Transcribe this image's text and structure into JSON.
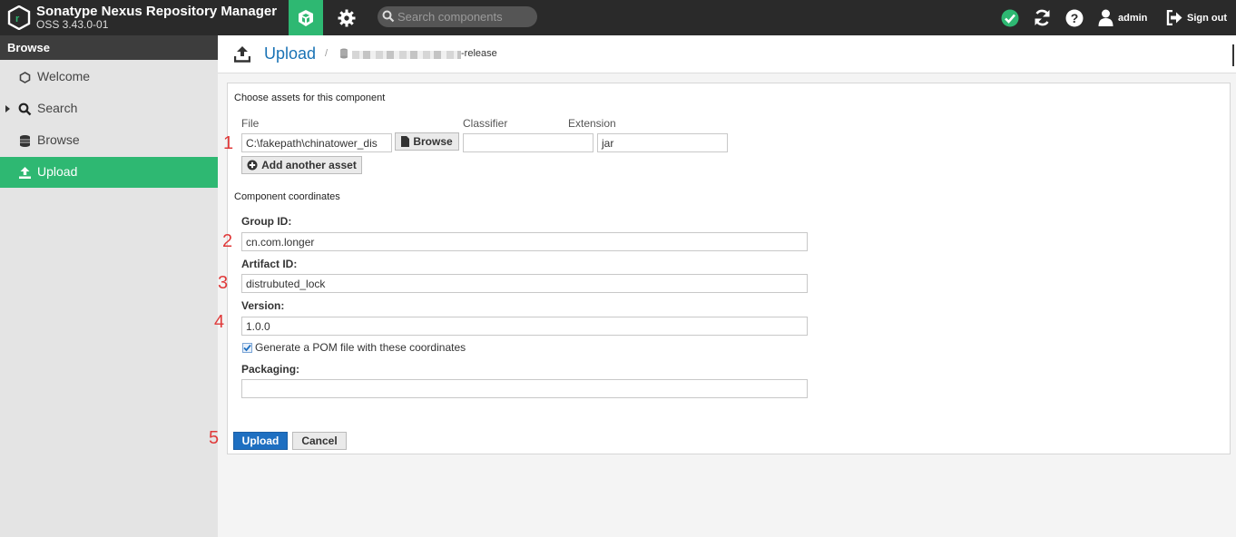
{
  "app": {
    "title": "Sonatype Nexus Repository Manager",
    "version": "OSS 3.43.0-01"
  },
  "header": {
    "search_placeholder": "Search components",
    "user_label": "admin",
    "signout_label": "Sign out"
  },
  "sidebar": {
    "section": "Browse",
    "items": [
      {
        "label": "Welcome",
        "icon": "hexagon-icon"
      },
      {
        "label": "Search",
        "icon": "search-icon"
      },
      {
        "label": "Browse",
        "icon": "database-icon"
      },
      {
        "label": "Upload",
        "icon": "upload-icon",
        "active": true
      }
    ]
  },
  "page": {
    "title": "Upload",
    "repo_suffix": "-release"
  },
  "assets": {
    "section_title": "Choose assets for this component",
    "file_label": "File",
    "classifier_label": "Classifier",
    "extension_label": "Extension",
    "file_value": "C:\\fakepath\\chinatower_dis",
    "browse_label": "Browse",
    "classifier_value": "",
    "extension_value": "jar",
    "add_asset_label": "Add another asset"
  },
  "coordinates": {
    "section_title": "Component coordinates",
    "group_label": "Group ID:",
    "group_value": "cn.com.longer",
    "artifact_label": "Artifact ID:",
    "artifact_value": "distrubuted_lock",
    "version_label": "Version:",
    "version_value": "1.0.0",
    "pom_label": "Generate a POM file with these coordinates",
    "pom_checked": true,
    "packaging_label": "Packaging:",
    "packaging_value": ""
  },
  "actions": {
    "upload_label": "Upload",
    "cancel_label": "Cancel"
  },
  "annotations": [
    "1",
    "2",
    "3",
    "4",
    "5"
  ],
  "colors": {
    "accent_green": "#2eb872",
    "header_bg": "#2a2a2a",
    "primary_blue": "#1e6fc1",
    "annotation_red": "#e03a3a"
  }
}
